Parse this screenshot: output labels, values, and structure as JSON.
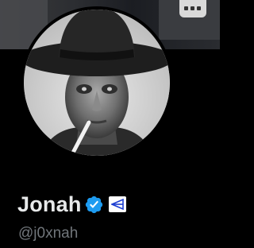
{
  "profile": {
    "display_name": "Jonah",
    "handle": "@j0xnah",
    "verified": true,
    "affiliate_badge": true
  },
  "icons": {
    "verified": "verified-badge-icon",
    "affiliate": "affiliate-badge-icon"
  },
  "colors": {
    "background": "#000000",
    "name": "#e7e9ea",
    "handle": "#71767b",
    "verified_badge": "#1d9bf0",
    "affiliate_badge_mark": "#1d3fd1"
  }
}
